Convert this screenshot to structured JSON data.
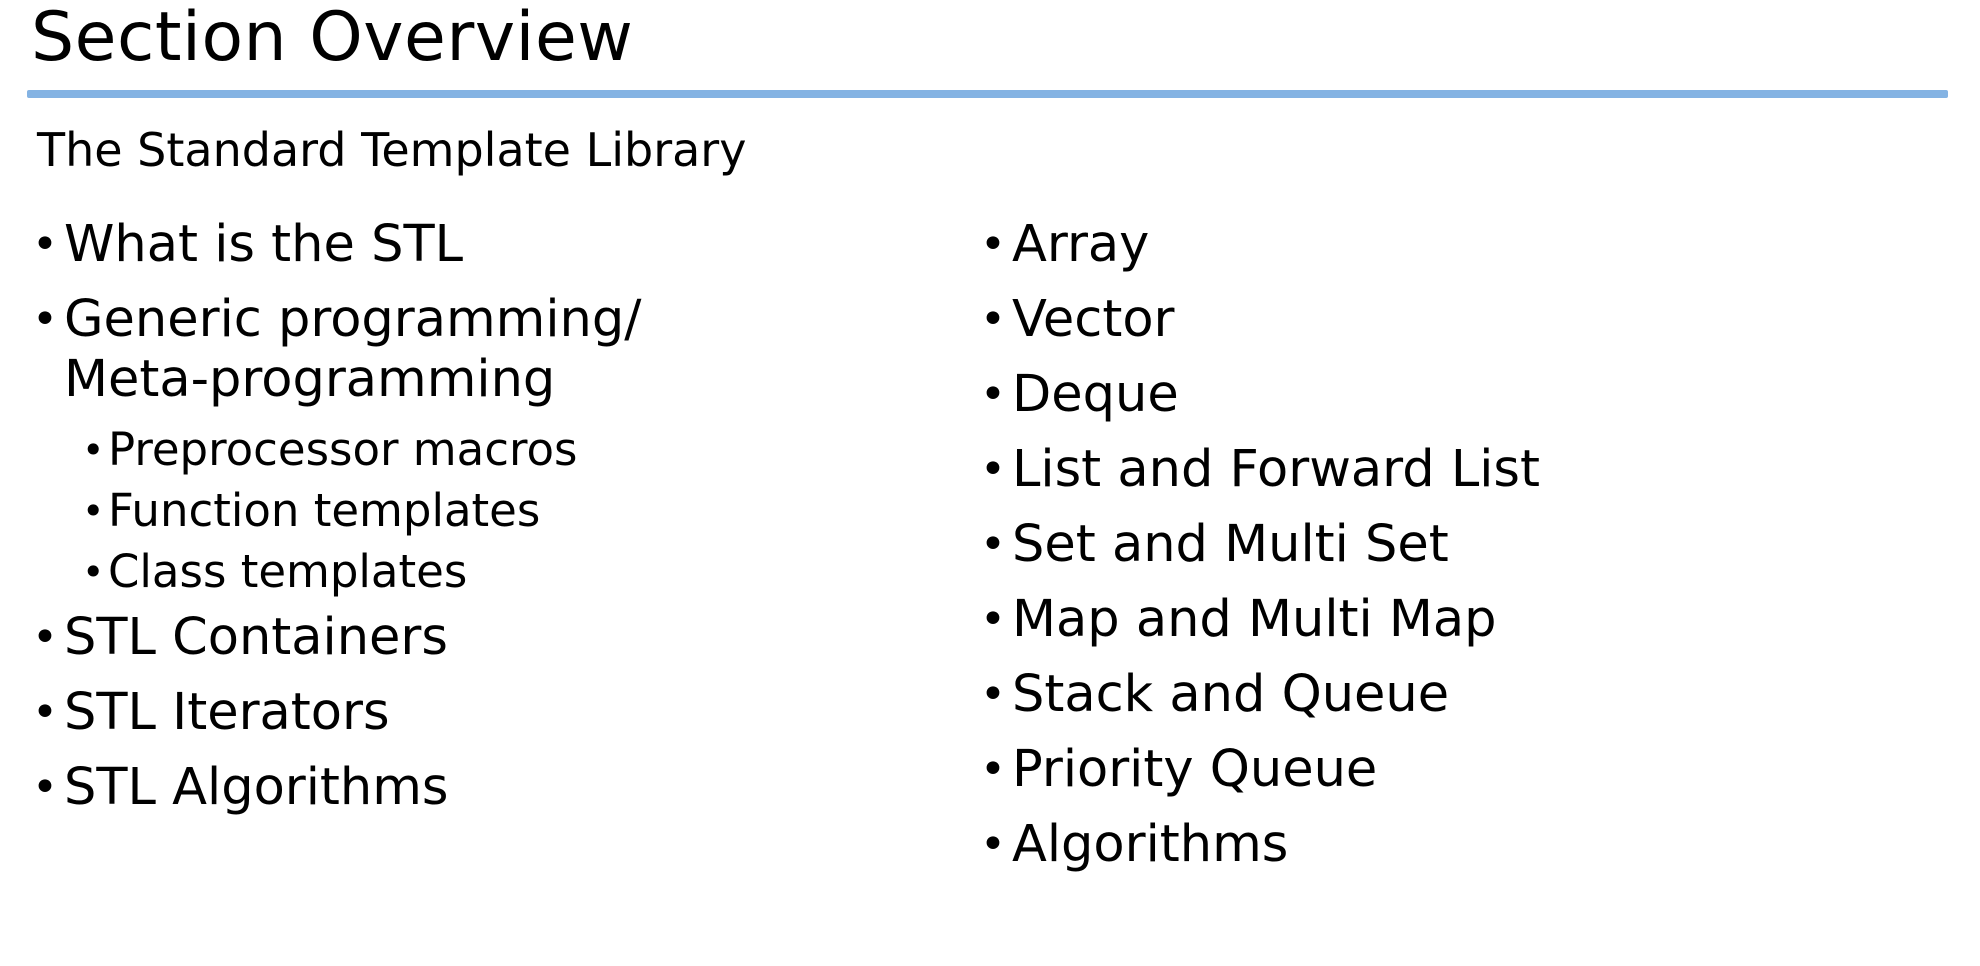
{
  "slide": {
    "title": "Section Overview",
    "subtitle": "The Standard Template Library",
    "accent_color": "#84b3e3",
    "left_column": [
      {
        "label": "What is the STL",
        "level": 1
      },
      {
        "label": "Generic programming/\nMeta-programming",
        "level": 1
      },
      {
        "label": "Preprocessor macros",
        "level": 2
      },
      {
        "label": "Function templates",
        "level": 2
      },
      {
        "label": "Class templates",
        "level": 2
      },
      {
        "label": "STL Containers",
        "level": 1
      },
      {
        "label": "STL Iterators",
        "level": 1
      },
      {
        "label": "STL Algorithms",
        "level": 1
      }
    ],
    "right_column": [
      {
        "label": "Array",
        "level": 1
      },
      {
        "label": "Vector",
        "level": 1
      },
      {
        "label": "Deque",
        "level": 1
      },
      {
        "label": "List and Forward List",
        "level": 1
      },
      {
        "label": "Set and Multi Set",
        "level": 1
      },
      {
        "label": "Map and Multi Map",
        "level": 1
      },
      {
        "label": "Stack and Queue",
        "level": 1
      },
      {
        "label": "Priority Queue",
        "level": 1
      },
      {
        "label": "Algorithms",
        "level": 1
      }
    ],
    "bullet_glyph": "•"
  }
}
